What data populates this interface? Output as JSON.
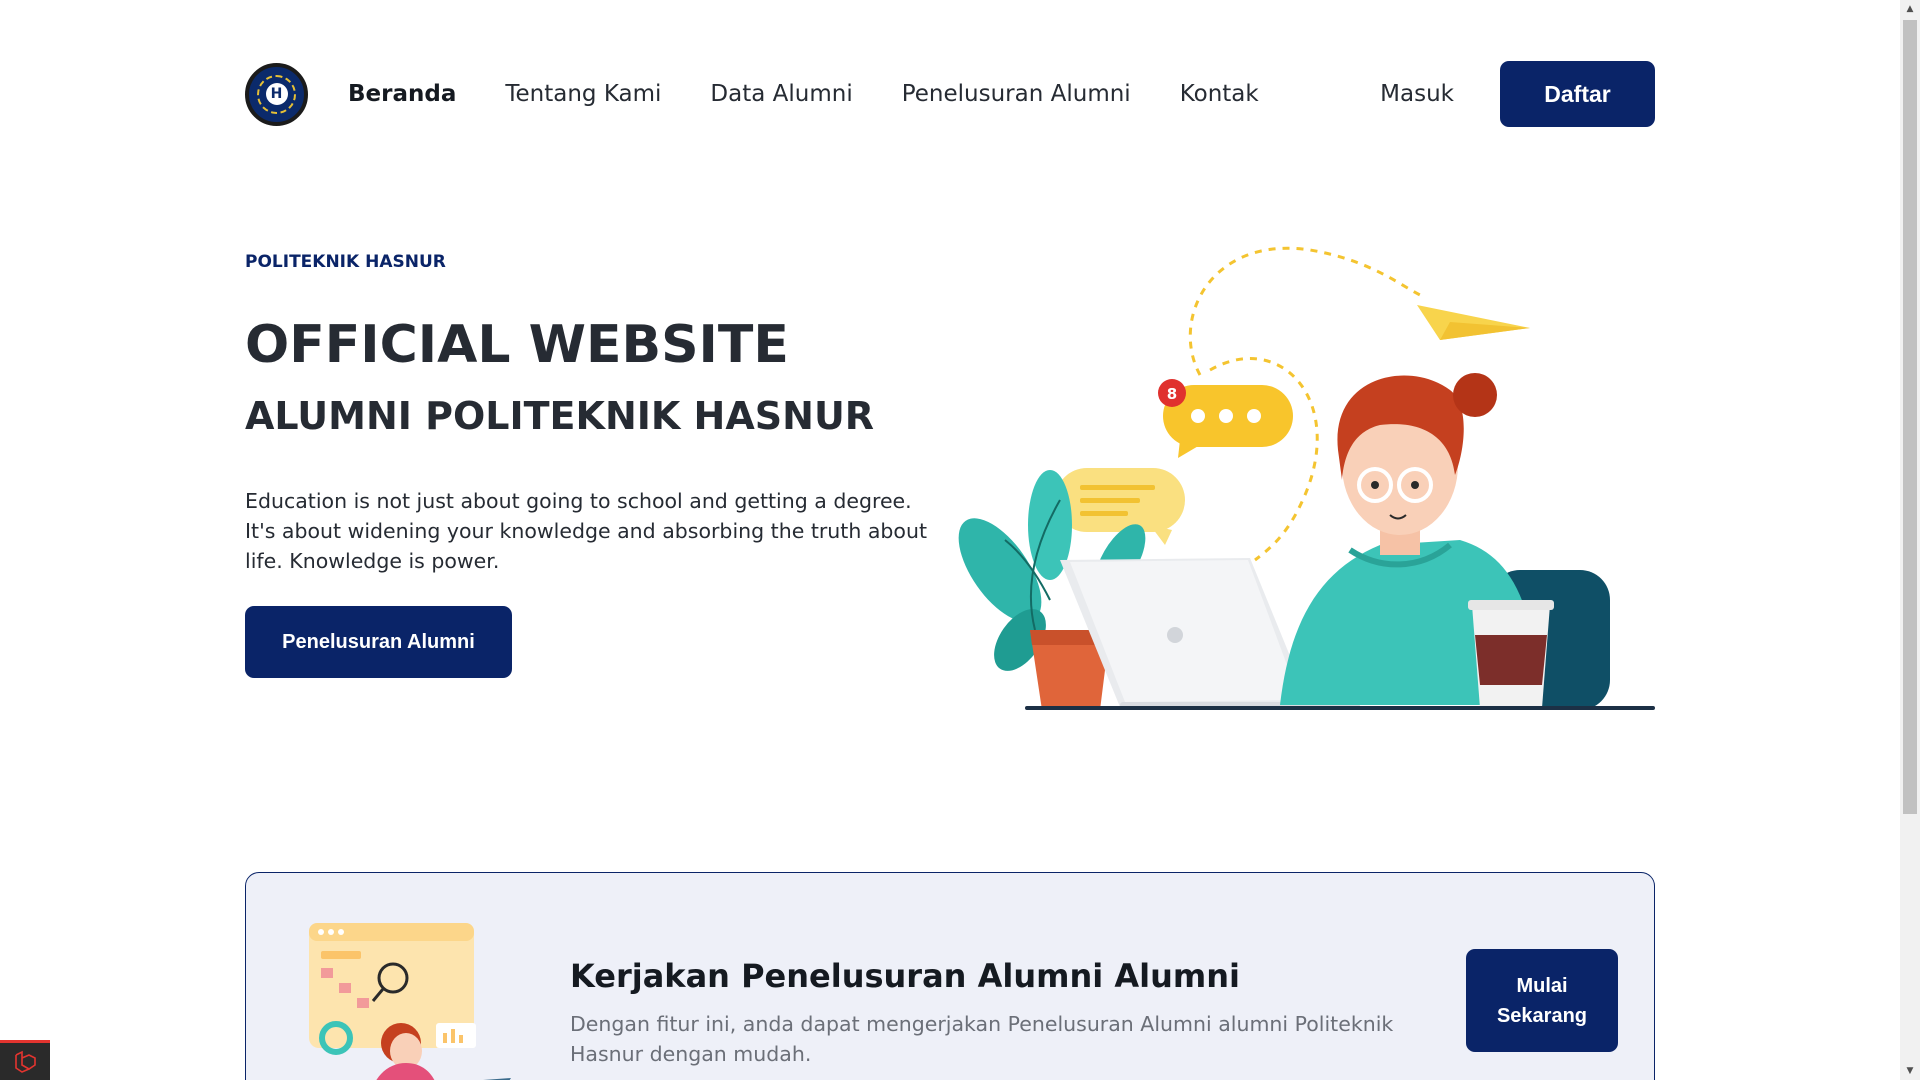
{
  "nav": {
    "logo_icon": "politeknik-hasnur-logo",
    "logo_letter": "H",
    "links": [
      {
        "label": "Beranda",
        "active": true
      },
      {
        "label": "Tentang Kami",
        "active": false
      },
      {
        "label": "Data Alumni",
        "active": false
      },
      {
        "label": "Penelusuran Alumni",
        "active": false
      },
      {
        "label": "Kontak",
        "active": false
      }
    ],
    "login_label": "Masuk",
    "register_label": "Daftar"
  },
  "hero": {
    "eyebrow": "POLITEKNIK HASNUR",
    "title": "OFFICIAL WEBSITE",
    "subtitle": "ALUMNI POLITEKNIK HASNUR",
    "text": "Education is not just about going to school and getting a degree. It's about widening your knowledge and absorbing the truth about life. Knowledge is power.",
    "button_label": "Penelusuran Alumni",
    "notification_count": "8"
  },
  "card": {
    "title": "Kerjakan Penelusuran Alumni Alumni",
    "text": "Dengan fitur ini, anda dapat mengerjakan Penelusuran Alumni alumni Politeknik Hasnur dengan mudah.",
    "button_label": "Mulai Sekarang"
  },
  "colors": {
    "primary": "#0a2468",
    "text": "#262b33",
    "muted": "#6b6f78",
    "card_bg": "#eef0f8"
  },
  "icons": {
    "debugbar": "laravel-icon",
    "scroll_up": "triangle-up-icon",
    "scroll_down": "triangle-down-icon"
  }
}
